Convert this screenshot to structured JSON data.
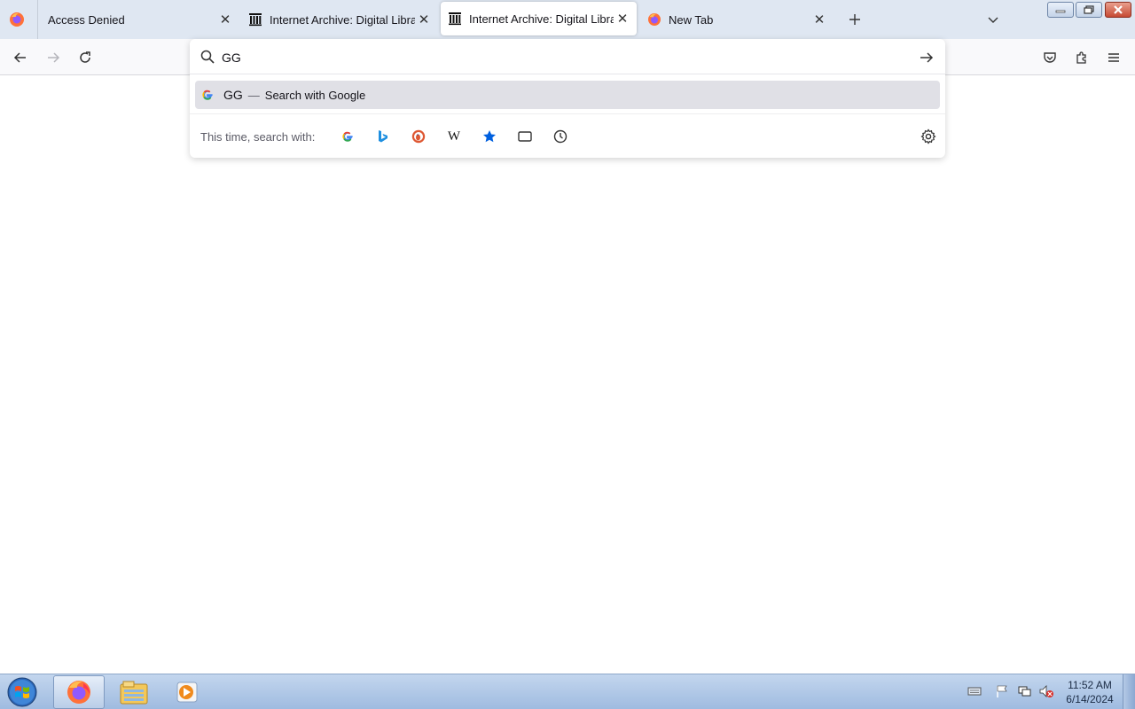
{
  "tabs": [
    {
      "title": "Access Denied",
      "icon": "firefox-icon",
      "selected": false
    },
    {
      "title": "Internet Archive: Digital Library",
      "icon": "internet-archive-icon",
      "selected": false
    },
    {
      "title": "Internet Archive: Digital Library",
      "icon": "internet-archive-icon",
      "selected": true
    },
    {
      "title": "New Tab",
      "icon": "firefox-icon",
      "selected": false
    }
  ],
  "urlbar": {
    "value": "GG",
    "suggestion": {
      "query": "GG",
      "separator": "—",
      "action": "Search with Google"
    },
    "oneoff_label": "This time, search with:",
    "engines": [
      "google-icon",
      "bing-icon",
      "duckduckgo-icon",
      "wikipedia-icon",
      "bookmarks-icon",
      "tabs-icon",
      "history-icon"
    ]
  },
  "taskbar": {
    "time": "11:52 AM",
    "date": "6/14/2024",
    "apps": [
      "firefox-icon",
      "file-explorer-icon",
      "media-player-icon"
    ]
  },
  "colors": {
    "tabstrip": "#dfe7f2",
    "firefox_orange": "#ff7139",
    "bookmark_blue": "#0060df"
  }
}
